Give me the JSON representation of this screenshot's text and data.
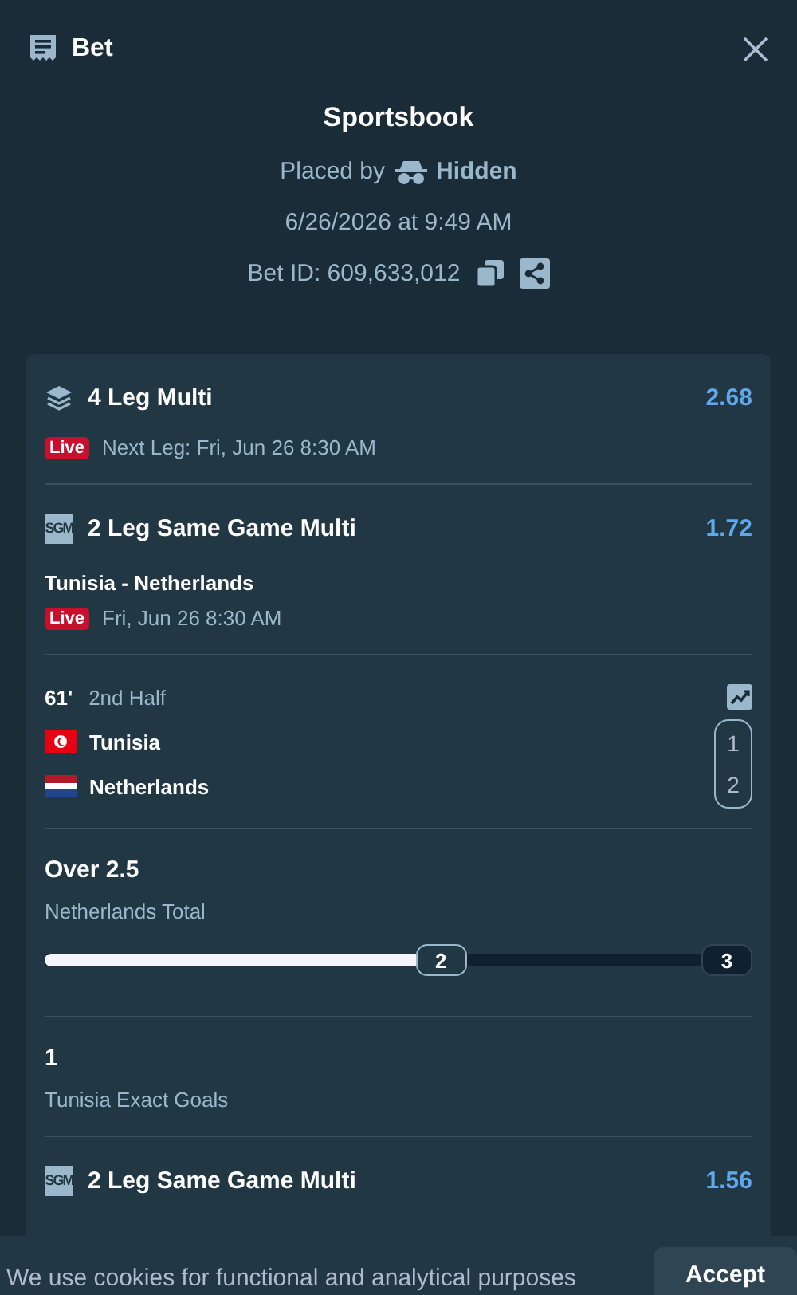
{
  "header": {
    "title": "Bet"
  },
  "summary": {
    "title": "Sportsbook",
    "placed_by_label": "Placed by",
    "placed_by": "Hidden",
    "placed_at": "6/26/2026 at 9:49 AM",
    "bet_id": "Bet ID: 609,633,012"
  },
  "multi": {
    "title": "4 Leg Multi",
    "odds": "2.68",
    "live_badge": "Live",
    "next_leg": "Next Leg: Fri, Jun 26 8:30 AM"
  },
  "legs": [
    {
      "kind": "sgm",
      "badge": "SGM",
      "title": "2 Leg Same Game Multi",
      "odds": "1.72",
      "match": "Tunisia - Netherlands",
      "live_badge": "Live",
      "time": "Fri, Jun 26 8:30 AM"
    },
    {
      "kind": "score",
      "minute": "61'",
      "period": "2nd Half",
      "teams": [
        {
          "name": "Tunisia",
          "kind": "tunisia",
          "score": "1"
        },
        {
          "name": "Netherlands",
          "kind": "netherlands",
          "score": "2"
        }
      ]
    },
    {
      "kind": "progress",
      "title": "Over 2.5",
      "market": "Netherlands Total",
      "level": 0.56,
      "current": "2",
      "target": "3"
    },
    {
      "kind": "selection",
      "title": "1",
      "market": "Tunisia Exact Goals"
    },
    {
      "kind": "sgm",
      "badge": "SGM",
      "title": "2 Leg Same Game Multi",
      "odds": "1.56"
    }
  ],
  "cookie_banner": {
    "text": "We use cookies for functional and analytical purposes",
    "button": "Accept"
  }
}
